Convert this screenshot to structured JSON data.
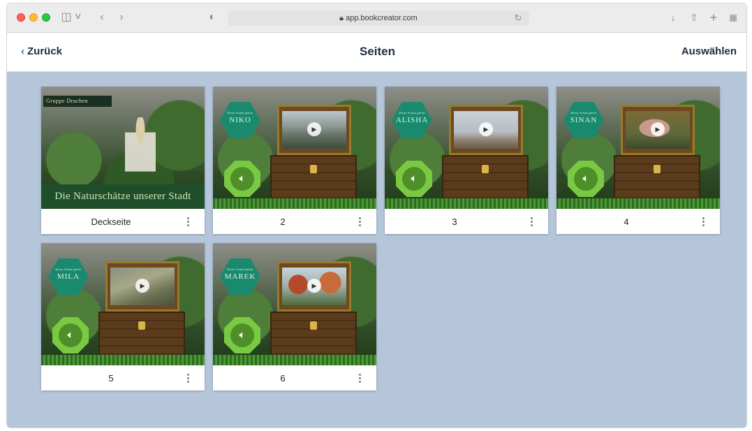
{
  "browser": {
    "url": "app.bookcreator.com"
  },
  "header": {
    "back_label": "Zurück",
    "title": "Seiten",
    "select_label": "Auswählen"
  },
  "cover": {
    "badge": "Gruppe Drachen",
    "title": "Die Naturschätze unserer Stadt",
    "label": "Deckseite"
  },
  "pages": [
    {
      "label": "2",
      "name": "NIKO"
    },
    {
      "label": "3",
      "name": "ALISHA"
    },
    {
      "label": "4",
      "name": "SINAN"
    },
    {
      "label": "5",
      "name": "MILA"
    },
    {
      "label": "6",
      "name": "MAREK"
    }
  ],
  "hex_subtitle": "Dieser Schatz gehört",
  "colors": {
    "content_bg": "#b5c6db",
    "hex": "#1a8a6e",
    "speaker": "#7ac943"
  }
}
